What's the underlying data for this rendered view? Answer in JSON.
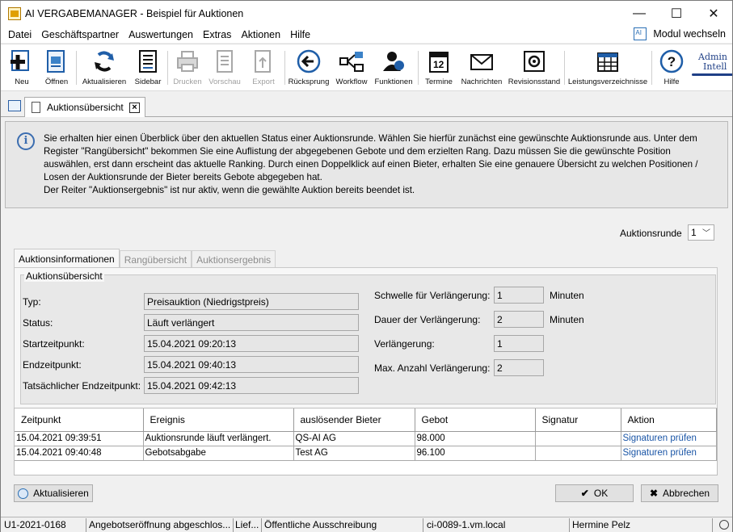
{
  "window": {
    "title": "AI VERGABEMANAGER - Beispiel für Auktionen",
    "minimize": "—",
    "maximize": "☐",
    "close": "✕"
  },
  "menu": {
    "items": [
      "Datei",
      "Geschäftspartner",
      "Auswertungen",
      "Extras",
      "Aktionen",
      "Hilfe"
    ],
    "modul": "Modul wechseln"
  },
  "toolbar": {
    "neu": "Neu",
    "oeffnen": "Öffnen",
    "aktualisieren": "Aktualisieren",
    "sidebar": "Sidebar",
    "drucken": "Drucken",
    "vorschau": "Vorschau",
    "export": "Export",
    "ruecksprung": "Rücksprung",
    "workflow": "Workflow",
    "funktionen": "Funktionen",
    "termine": "Termine",
    "termine_day": "12",
    "nachrichten": "Nachrichten",
    "revisionsstand": "Revisionsstand",
    "leistungsverzeichnisse": "Leistungsverzeichnisse",
    "hilfe": "Hilfe",
    "logo_line1": "Admin",
    "logo_line2": "Intell"
  },
  "doc_tab": {
    "label": "Auktionsübersicht",
    "close": "×"
  },
  "info": {
    "icon": "i",
    "text_lines": [
      "Sie erhalten hier einen Überblick über den aktuellen Status einer Auktionsrunde. Wählen Sie hierfür zunächst eine gewünschte Auktionsrunde aus. Unter dem",
      "Register \"Rangübersicht\" bekommen Sie eine Auflistung der abgegebenen Gebote und dem erzielten Rang. Dazu müssen Sie die gewünschte Position",
      "auswählen, erst dann erscheint das aktuelle Ranking. Durch einen Doppelklick auf einen Bieter, erhalten Sie eine genauere Übersicht zu welchen Positionen /",
      "Losen der Auktionsrunde der Bieter bereits Gebote abgegeben hat.",
      "Der Reiter \"Auktionsergebnis\" ist nur aktiv, wenn die gewählte Auktion bereits beendet ist."
    ]
  },
  "round": {
    "label": "Auktionsrunde",
    "value": "1",
    "chevron": "﹀"
  },
  "tabs": [
    "Auktionsinformationen",
    "Rangübersicht",
    "Auktionsergebnis"
  ],
  "overview": {
    "title": "Auktionsübersicht",
    "left_fields": [
      {
        "label": "Typ:",
        "value": "Preisauktion (Niedrigstpreis)"
      },
      {
        "label": "Status:",
        "value": "Läuft verlängert"
      },
      {
        "label": "Startzeitpunkt:",
        "value": "15.04.2021 09:20:13"
      },
      {
        "label": "Endzeitpunkt:",
        "value": "15.04.2021 09:40:13"
      },
      {
        "label": "Tatsächlicher Endzeitpunkt:",
        "value": "15.04.2021 09:42:13"
      }
    ],
    "right_fields": [
      {
        "label": "Schwelle für Verlängerung:",
        "value": "1",
        "unit": "Minuten"
      },
      {
        "label": "Dauer der Verlängerung:",
        "value": "2",
        "unit": "Minuten"
      },
      {
        "label": "Verlängerung:",
        "value": "1",
        "unit": ""
      },
      {
        "label": "Max. Anzahl Verlängerung:",
        "value": "2",
        "unit": ""
      }
    ]
  },
  "table": {
    "headers": [
      "Zeitpunkt",
      "Ereignis",
      "auslösender Bieter",
      "Gebot",
      "Signatur",
      "Aktion"
    ],
    "rows": [
      [
        "15.04.2021 09:39:51",
        "Auktionsrunde läuft verlängert.",
        "QS-AI AG",
        "98.000",
        "",
        "Signaturen prüfen"
      ],
      [
        "15.04.2021 09:40:48",
        "Gebotsabgabe",
        "Test AG",
        "96.100",
        "",
        "Signaturen prüfen"
      ]
    ]
  },
  "buttons": {
    "aktualisieren": "Aktualisieren",
    "ok": "OK",
    "ok_icon": "✔",
    "abbrechen": "Abbrechen",
    "abbrechen_icon": "✖"
  },
  "status": {
    "id": "U1-2021-0168",
    "phase": "Angebotseröffnung abgeschlos...",
    "lief": "Lief...",
    "verfahren": "Öffentliche Ausschreibung",
    "server": "ci-0089-1.vm.local",
    "user": "Hermine Pelz"
  },
  "colors": {
    "accent": "#2a6fb5",
    "link": "#1a55a6",
    "logo": "#1f3f86"
  }
}
